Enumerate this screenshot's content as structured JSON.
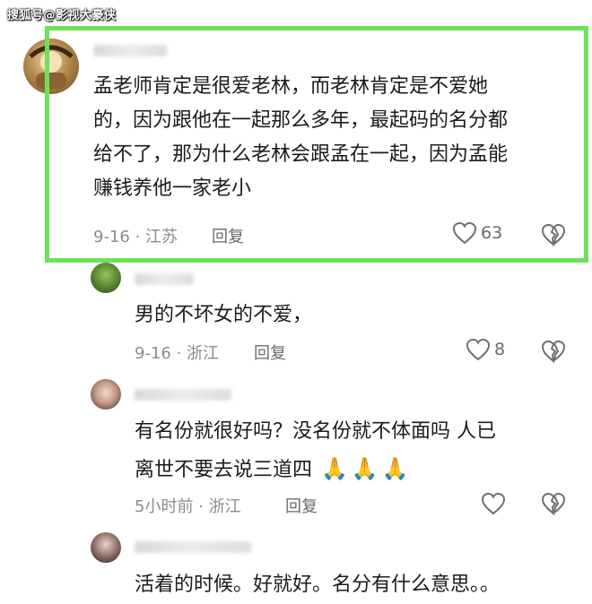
{
  "watermark": "搜狐号@影视大豪侠",
  "comments": [
    {
      "lines": [
        "孟老师肯定是很爱老林，而老林肯定是不爱她",
        "的，因为跟他在一起那么多年，最起码的名分都",
        "给不了，那为什么老林会跟孟在一起，因为孟能",
        "赚钱养他一家老小"
      ],
      "meta": "9-16 · 江苏",
      "reply": "回复",
      "likes": "63"
    },
    {
      "lines": [
        "男的不坏女的不爱，"
      ],
      "meta": "9-16 · 浙江",
      "reply": "回复",
      "likes": "8"
    },
    {
      "lines": [
        "有名份就很好吗？没名份就不体面吗  人已",
        "离世不要去说三道四"
      ],
      "emoji": "🙏🙏🙏",
      "meta": "5小时前 · 浙江",
      "reply": "回复",
      "likes": ""
    },
    {
      "lines": [
        "活着的时候。好就好。名分有什么意思。。"
      ]
    }
  ],
  "colors": {
    "highlight": "#6fe05a",
    "meta": "#8c8c8c"
  }
}
